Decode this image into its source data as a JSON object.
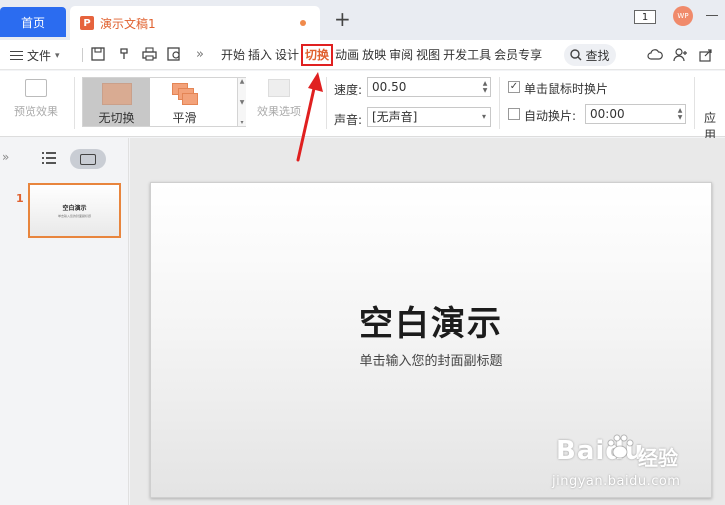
{
  "tabbar": {
    "home_label": "首页",
    "doc_icon_letter": "P",
    "doc_title": "演示文稿1",
    "new_tab_symbol": "+",
    "page_indicator": "1",
    "avatar_text": "WP"
  },
  "menu": {
    "file_label": "文件",
    "more_symbol": "»",
    "tabs": [
      {
        "label": "开始",
        "active": false
      },
      {
        "label": "插入",
        "active": false
      },
      {
        "label": "设计",
        "active": false
      },
      {
        "label": "切换",
        "active": true
      },
      {
        "label": "动画",
        "active": false
      },
      {
        "label": "放映",
        "active": false
      },
      {
        "label": "审阅",
        "active": false
      },
      {
        "label": "视图",
        "active": false
      },
      {
        "label": "开发工具",
        "active": false
      },
      {
        "label": "会员专享",
        "active": false
      }
    ],
    "search_label": "查找"
  },
  "ribbon": {
    "preview_label": "预览效果",
    "transitions": [
      {
        "label": "无切换",
        "selected": true
      },
      {
        "label": "平滑",
        "selected": false
      }
    ],
    "effect_options_label": "效果选项",
    "speed_label": "速度:",
    "speed_value": "00.50",
    "sound_label": "声音:",
    "sound_value": "[无声音]",
    "on_click_label": "单击鼠标时换片",
    "on_click_checked": true,
    "auto_label": "自动换片:",
    "auto_checked": false,
    "auto_value": "00:00",
    "apply_label": "应用"
  },
  "panel": {
    "collapse_symbol": "»",
    "slide_number": "1",
    "thumb_title": "空白演示",
    "thumb_subtitle": "单击输入您的封面副标题"
  },
  "slide": {
    "title": "空白演示",
    "subtitle": "单击输入您的封面副标题"
  },
  "watermark": {
    "brand": "Baidu",
    "cn": "经验",
    "url": "jingyan.baidu.com"
  },
  "colors": {
    "accent": "#e0612f",
    "home_tab": "#2b6cf0",
    "highlight_box": "#e02020"
  }
}
